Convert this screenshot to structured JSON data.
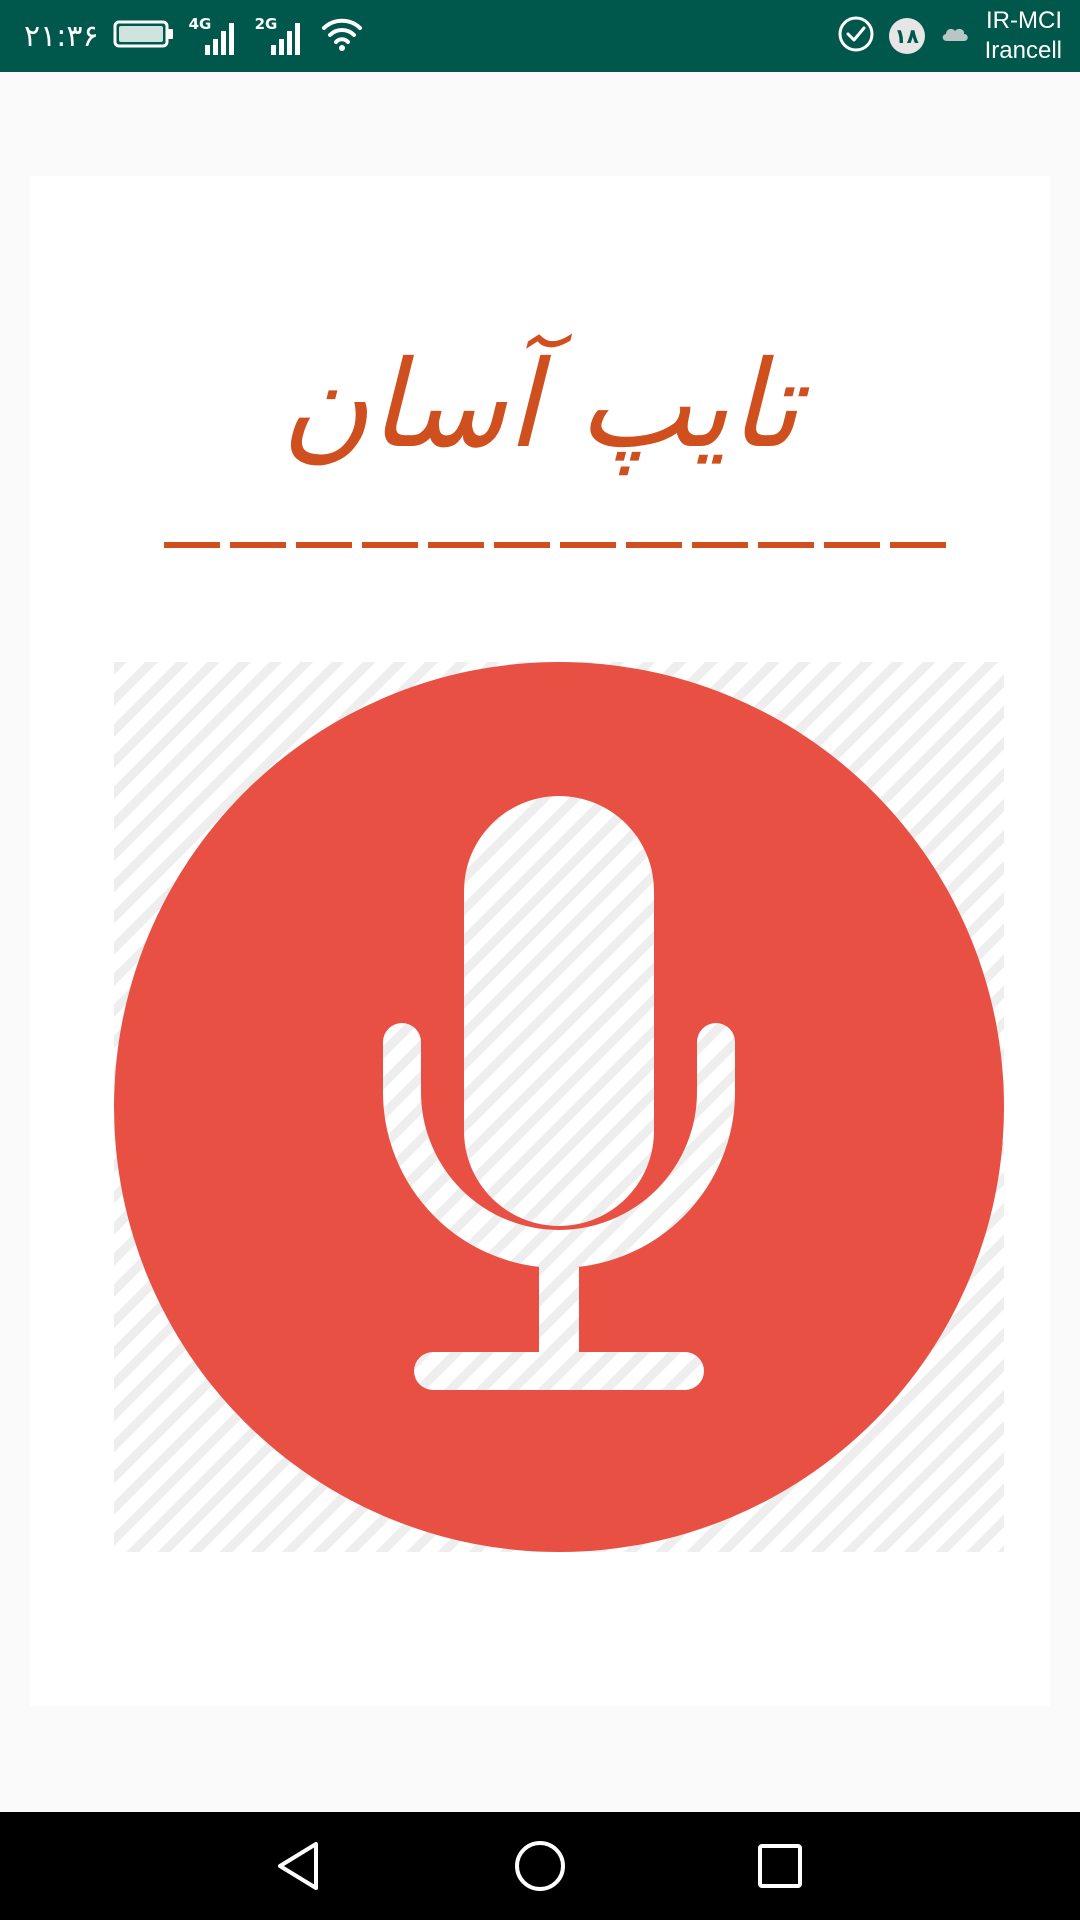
{
  "status_bar": {
    "time": "۲۱:۳۶",
    "network_1": "4G",
    "network_2": "2G",
    "notification_count": "۱۸",
    "carrier_1": "IR-MCI",
    "carrier_2": "Irancell",
    "icons": [
      "battery-icon",
      "signal-4g-icon",
      "signal-2g-icon",
      "wifi-icon",
      "check-circle-icon",
      "notification-badge",
      "cloud-icon"
    ],
    "background_color": "#00574b"
  },
  "splash": {
    "title": "تایپ آسان",
    "title_color": "#cf4f1e",
    "logo_icon": "microphone-icon",
    "logo_color": "#e85044"
  },
  "navigation_bar": {
    "buttons": [
      "back-icon",
      "home-icon",
      "recents-icon"
    ]
  }
}
